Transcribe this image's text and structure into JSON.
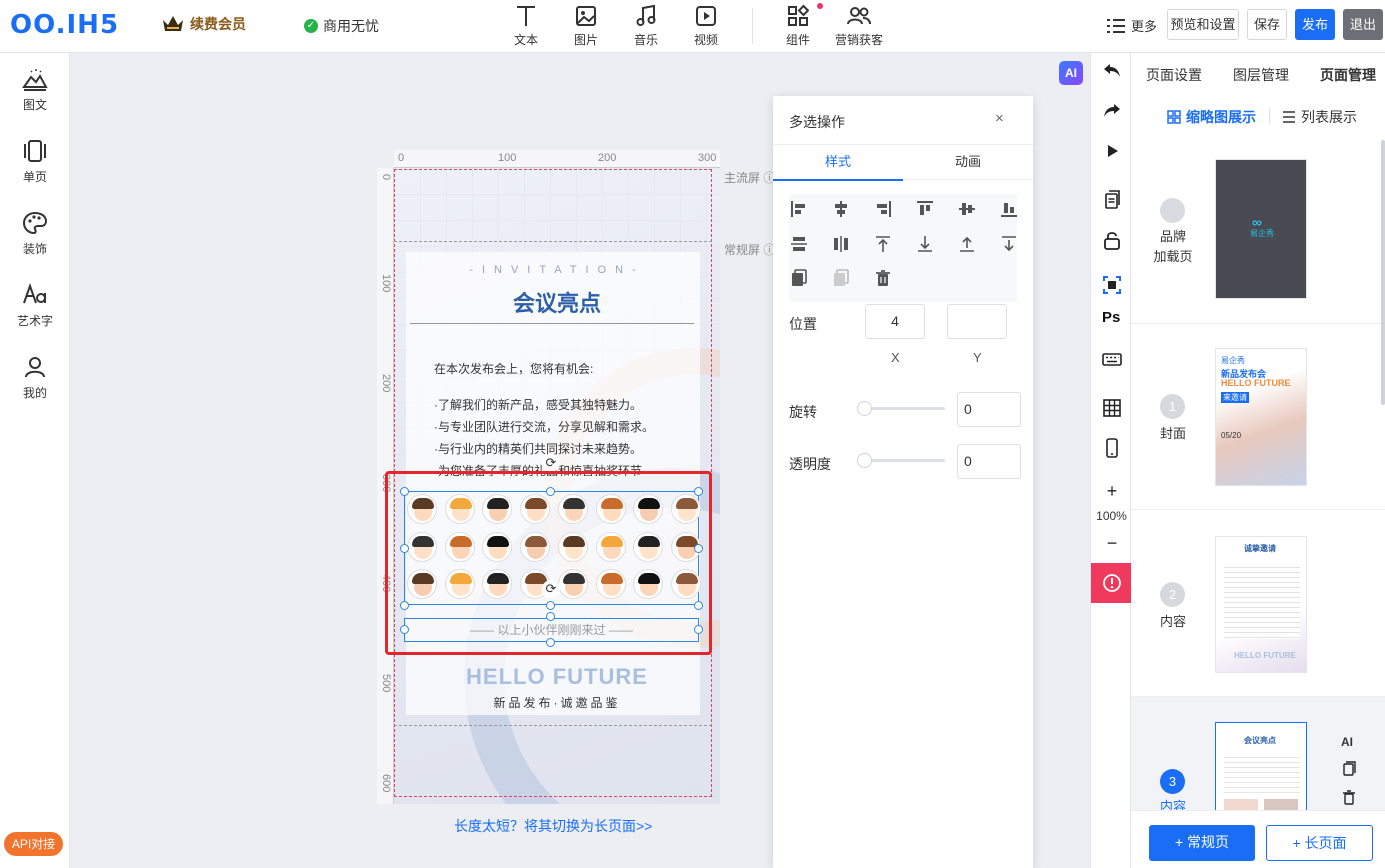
{
  "app": {
    "logo": "OO.IH5",
    "vip_label": "续费会员",
    "commercial_label": "商用无忧"
  },
  "toolbar": {
    "tools": [
      "文本",
      "图片",
      "音乐",
      "视频",
      "组件",
      "营销获客"
    ],
    "more": "更多",
    "preview": "预览和设置",
    "save": "保存",
    "publish": "发布",
    "exit": "退出"
  },
  "leftbar": {
    "items": [
      "图文",
      "单页",
      "装饰",
      "艺术字",
      "我的"
    ],
    "api_button": "API对接"
  },
  "canvas": {
    "ai_badge": "AI",
    "ruler_top": [
      "0",
      "100",
      "200",
      "300"
    ],
    "ruler_left": [
      "0",
      "100",
      "200",
      "300",
      "400",
      "500",
      "600"
    ],
    "guides": {
      "main_screen": "主流屏",
      "normal_screen": "常规屏"
    },
    "page": {
      "invitation": "-INVITATION-",
      "title": "会议亮点",
      "intro": "在本次发布会上，您将有机会:",
      "bullets": [
        "·了解我们的新产品，感受其独特魅力。",
        "·与专业团队进行交流，分享见解和需求。",
        "·与行业内的精英们共同探讨未来趋势。",
        "·为您准备了丰厚的礼品和惊喜抽奖环节"
      ],
      "caption": "—— 以上小伙伴刚刚来过 ——",
      "hello": "HELLO FUTURE",
      "slogan": "新品发布·诚邀品鉴"
    },
    "switch_link": "长度太短？将其切换为长页面>>"
  },
  "multiselect_panel": {
    "title": "多选操作",
    "close": "×",
    "tabs": [
      "样式",
      "动画"
    ],
    "active_tab": "样式",
    "position_label": "位置",
    "position_x": "4",
    "position_y": "",
    "x_label": "X",
    "y_label": "Y",
    "rotate_label": "旋转",
    "rotate_value": "0",
    "opacity_label": "透明度",
    "opacity_value": "0"
  },
  "toolstrip": {
    "zoom": "100%",
    "ps_label": "Ps",
    "plus": "+",
    "minus": "−"
  },
  "right_panel": {
    "tabs": [
      "页面设置",
      "图层管理",
      "页面管理"
    ],
    "active_tab": "页面管理",
    "view_thumb": "缩略图展示",
    "view_list": "列表展示",
    "pages": [
      {
        "num": "",
        "name": "品牌\n加载页",
        "thumb_text": "易企秀"
      },
      {
        "num": "1",
        "name": "封面",
        "thumb_text": "新品发布会"
      },
      {
        "num": "2",
        "name": "内容",
        "thumb_text": "诚挚邀请"
      },
      {
        "num": "3",
        "name": "内容",
        "thumb_text": "会议亮点"
      }
    ],
    "cover_thumb": {
      "brand": "易企秀",
      "title1": "新品发布会",
      "title2": "HELLO FUTURE",
      "tag": "来邀请",
      "date": "05/20"
    },
    "content2_thumb_hello": "HELLO FUTURE",
    "side_ops": [
      "AI"
    ],
    "add_normal": "+ 常规页",
    "add_long": "+ 长页面"
  },
  "colors": {
    "accent": "#1a6ef5",
    "selection": "#2b86e0",
    "highlight": "#e2262b",
    "warning": "#ef3a5d",
    "api": "#f2742c"
  }
}
